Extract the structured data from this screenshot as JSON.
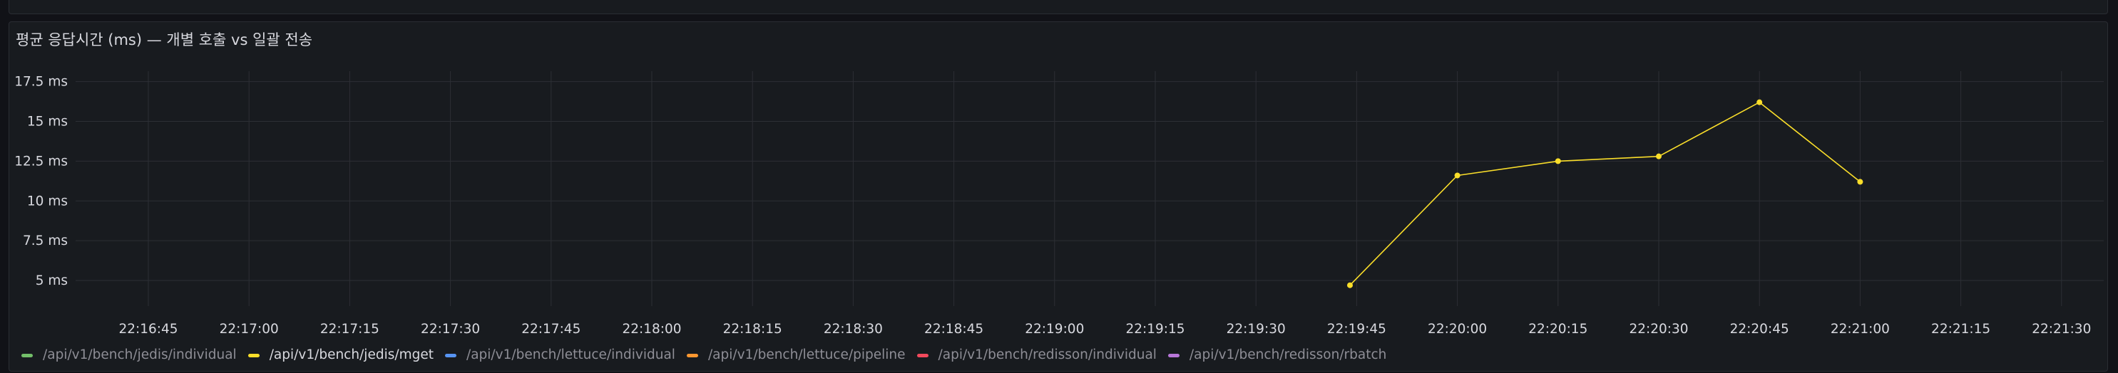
{
  "panel": {
    "title": "평균 응답시간 (ms) — 개별 호출 vs 일괄 전송"
  },
  "colors": {
    "background": "#111217",
    "panel_bg": "#181b1f",
    "grid": "#2c2f35",
    "axis_text": "#d8d9df"
  },
  "chart_data": {
    "type": "line",
    "title": "평균 응답시간 (ms) — 개별 호출 vs 일괄 전송",
    "xlabel": "",
    "ylabel": "",
    "x_ticks": [
      "22:16:45",
      "22:17:00",
      "22:17:15",
      "22:17:30",
      "22:17:45",
      "22:18:00",
      "22:18:15",
      "22:18:30",
      "22:18:45",
      "22:19:00",
      "22:19:15",
      "22:19:30",
      "22:19:45",
      "22:20:00",
      "22:20:15",
      "22:20:30",
      "22:20:45",
      "22:21:00",
      "22:21:15",
      "22:21:30"
    ],
    "y_ticks": [
      {
        "value": 5,
        "label": "5 ms"
      },
      {
        "value": 7.5,
        "label": "7.5 ms"
      },
      {
        "value": 10,
        "label": "10 ms"
      },
      {
        "value": 12.5,
        "label": "12.5 ms"
      },
      {
        "value": 15,
        "label": "15 ms"
      },
      {
        "value": 17.5,
        "label": "17.5 ms"
      }
    ],
    "ylim": [
      3.3,
      17.5
    ],
    "grid": true,
    "legend_position": "bottom-left",
    "series": [
      {
        "name": "/api/v1/bench/jedis/individual",
        "color": "#73bf69",
        "points": []
      },
      {
        "name": "/api/v1/bench/jedis/mget",
        "color": "#fade2a",
        "points": [
          {
            "x": "22:19:44",
            "y": 4.7
          },
          {
            "x": "22:20:00",
            "y": 11.6
          },
          {
            "x": "22:20:15",
            "y": 12.5
          },
          {
            "x": "22:20:30",
            "y": 12.8
          },
          {
            "x": "22:20:45",
            "y": 16.2
          },
          {
            "x": "22:21:00",
            "y": 11.2
          }
        ]
      },
      {
        "name": "/api/v1/bench/lettuce/individual",
        "color": "#5794f2",
        "points": []
      },
      {
        "name": "/api/v1/bench/lettuce/pipeline",
        "color": "#ff9830",
        "points": []
      },
      {
        "name": "/api/v1/bench/redisson/individual",
        "color": "#f2495c",
        "points": []
      },
      {
        "name": "/api/v1/bench/redisson/rbatch",
        "color": "#b877d9",
        "points": []
      }
    ]
  }
}
